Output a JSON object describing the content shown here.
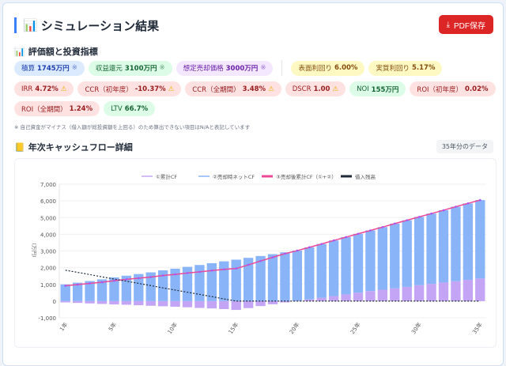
{
  "header": {
    "title": "シミュレーション結果",
    "title_icon": "bar-chart-icon",
    "pdf_label": "PDF保存",
    "pdf_icon": "download-icon"
  },
  "metrics": {
    "title": "評価額と投資指標",
    "row1": [
      {
        "label": "積算",
        "value": "1745万円",
        "suffix": "※",
        "tone": "blue"
      },
      {
        "label": "収益還元",
        "value": "3100万円",
        "suffix": "※",
        "tone": "green"
      },
      {
        "label": "想定売却価格",
        "value": "3000万円",
        "suffix": "※",
        "tone": "purple"
      }
    ],
    "row1b": [
      {
        "label": "表面利回り",
        "value": "6.00%",
        "tone": "yellow"
      },
      {
        "label": "実質利回り",
        "value": "5.17%",
        "tone": "yellow"
      }
    ],
    "row2": [
      {
        "label": "IRR",
        "value": "4.72%",
        "warn": true,
        "tone": "red"
      },
      {
        "label": "CCR（初年度）",
        "value": "-10.37%",
        "warn": true,
        "tone": "red"
      },
      {
        "label": "CCR（全期間）",
        "value": "3.48%",
        "warn": true,
        "tone": "red"
      },
      {
        "label": "DSCR",
        "value": "1.00",
        "warn": true,
        "tone": "red"
      },
      {
        "label": "NOI",
        "value": "155万円",
        "tone": "green"
      },
      {
        "label": "ROI（初年度）",
        "value": "0.02%",
        "tone": "red"
      }
    ],
    "row3": [
      {
        "label": "ROI（全期間）",
        "value": "1.24%",
        "tone": "red"
      },
      {
        "label": "LTV",
        "value": "66.7%",
        "tone": "green"
      }
    ],
    "note": "※ 自己資金がマイナス（借入額が総投資額を上回る）のため算出できない項目はN/Aと表記しています"
  },
  "cashflow": {
    "title": "年次キャッシュフロー詳細",
    "badge": "35年分のデータ"
  },
  "chart_data": {
    "type": "bar",
    "ylabel": "(万円)",
    "ylim": [
      -1000,
      7000
    ],
    "yticks": [
      7000,
      6000,
      5000,
      4000,
      3000,
      2000,
      1000,
      0,
      -1000
    ],
    "ytick_labels": [
      "7,000",
      "6,000",
      "5,000",
      "4,000",
      "3,000",
      "2,000",
      "1,000",
      "0",
      "-1,000"
    ],
    "categories": [
      "1年",
      "2年",
      "3年",
      "4年",
      "5年",
      "6年",
      "7年",
      "8年",
      "9年",
      "10年",
      "11年",
      "12年",
      "13年",
      "14年",
      "15年",
      "16年",
      "17年",
      "18年",
      "19年",
      "20年",
      "21年",
      "22年",
      "23年",
      "24年",
      "25年",
      "26年",
      "27年",
      "28年",
      "29年",
      "30年",
      "31年",
      "32年",
      "33年",
      "34年",
      "35年"
    ],
    "xtick_labels": [
      "1年",
      "5年",
      "10年",
      "15年",
      "20年",
      "25年",
      "30年",
      "35年"
    ],
    "grid": true,
    "legend": "top",
    "stacked": true,
    "series": [
      {
        "name": "①累計CF",
        "type": "bar",
        "color": "#c4a5f5",
        "values": [
          -80,
          -110,
          -140,
          -170,
          -200,
          -220,
          -250,
          -280,
          -310,
          -340,
          -370,
          -410,
          -440,
          -480,
          -530,
          -420,
          -300,
          -190,
          -80,
          20,
          100,
          200,
          300,
          400,
          500,
          600,
          680,
          760,
          850,
          950,
          1030,
          1110,
          1190,
          1270,
          1350
        ]
      },
      {
        "name": "②売却時ネットCF",
        "type": "bar",
        "color": "#8ab4f8",
        "values": [
          1000,
          1100,
          1200,
          1300,
          1420,
          1520,
          1620,
          1720,
          1840,
          1940,
          2050,
          2160,
          2270,
          2380,
          2480,
          2590,
          2700,
          2810,
          2920,
          3000,
          3120,
          3220,
          3330,
          3430,
          3530,
          3630,
          3750,
          3880,
          3990,
          4090,
          4210,
          4330,
          4460,
          4580,
          4700
        ]
      },
      {
        "name": "③売却後累計CF（①+②）",
        "type": "line",
        "color": "#ec4899",
        "values": [
          920,
          990,
          1060,
          1130,
          1220,
          1300,
          1370,
          1440,
          1530,
          1600,
          1680,
          1750,
          1830,
          1900,
          1950,
          2170,
          2400,
          2620,
          2840,
          3020,
          3220,
          3420,
          3630,
          3830,
          4030,
          4230,
          4430,
          4640,
          4840,
          5040,
          5240,
          5440,
          5650,
          5850,
          6050
        ]
      },
      {
        "name": "借入残高",
        "type": "line",
        "dashed": true,
        "color": "#1f2937",
        "values": [
          1850,
          1720,
          1590,
          1450,
          1320,
          1190,
          1060,
          930,
          790,
          660,
          530,
          400,
          270,
          130,
          0,
          0,
          0,
          0,
          0,
          0,
          0,
          0,
          0,
          0,
          0,
          0,
          0,
          0,
          0,
          0,
          0,
          0,
          0,
          0,
          0
        ]
      }
    ]
  }
}
